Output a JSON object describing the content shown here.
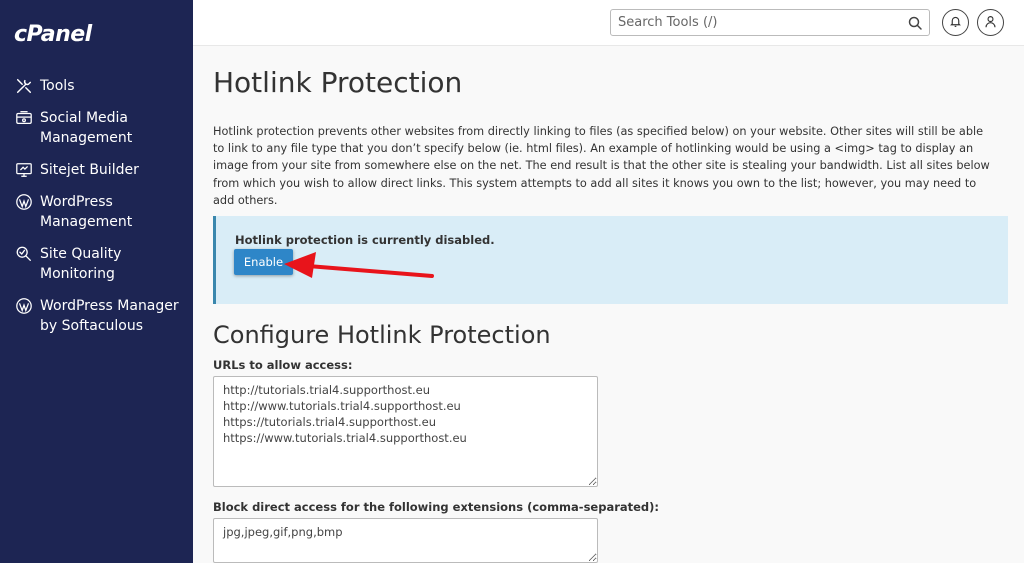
{
  "app": {
    "logo": "cPanel"
  },
  "sidebar": {
    "items": [
      {
        "label": "Tools",
        "icon": "tools-icon"
      },
      {
        "label": "Social Media Management",
        "icon": "social-media-icon"
      },
      {
        "label": "Sitejet Builder",
        "icon": "sitejet-icon"
      },
      {
        "label": "WordPress Management",
        "icon": "wordpress-icon"
      },
      {
        "label": "Site Quality Monitoring",
        "icon": "site-quality-icon"
      },
      {
        "label": "WordPress Manager by Softaculous",
        "icon": "wordpress-icon"
      }
    ]
  },
  "topbar": {
    "search_placeholder": "Search Tools (/)",
    "icons": [
      "search-icon",
      "bell-icon",
      "user-icon"
    ]
  },
  "page": {
    "title": "Hotlink Protection",
    "description": "Hotlink protection prevents other websites from directly linking to files (as specified below) on your website. Other sites will still be able to link to any file type that you don’t specify below (ie. html files). An example of hotlinking would be using a <img> tag to display an image from your site from somewhere else on the net. The end result is that the other site is stealing your bandwidth. List all sites below from which you wish to allow direct links. This system attempts to add all sites it knows you own to the list; however, you may need to add others."
  },
  "alert": {
    "status_text": "Hotlink protection is currently disabled.",
    "enable_label": "Enable"
  },
  "configure": {
    "title": "Configure Hotlink Protection",
    "urls_label": "URLs to allow access:",
    "urls": [
      "http://tutorials.trial4.supporthost.eu",
      "http://www.tutorials.trial4.supporthost.eu",
      "https://tutorials.trial4.supporthost.eu",
      "https://www.tutorials.trial4.supporthost.eu"
    ],
    "extensions_label": "Block direct access for the following extensions (comma-separated):",
    "extensions_value": "jpg,jpeg,gif,png,bmp"
  },
  "colors": {
    "sidebar_bg": "#1d2553",
    "alert_bg": "#d9edf7",
    "button_blue": "#2e86c8",
    "arrow_red": "#e8141b"
  }
}
